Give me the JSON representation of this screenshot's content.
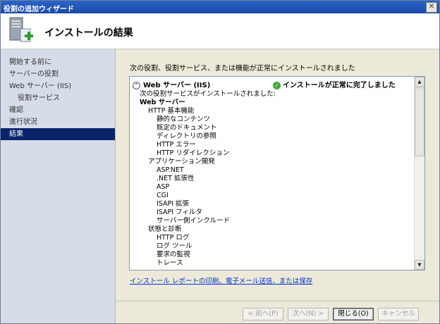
{
  "window": {
    "title": "役割の追加ウィザード",
    "close_glyph": "✕"
  },
  "header": {
    "title": "インストールの結果",
    "icon": "server-add-icon"
  },
  "nav": {
    "items": [
      {
        "label": "開始する前に",
        "active": false,
        "sub": false
      },
      {
        "label": "サーバーの役割",
        "active": false,
        "sub": false
      },
      {
        "label": "Web サーバー (IIS)",
        "active": false,
        "sub": false
      },
      {
        "label": "役割サービス",
        "active": false,
        "sub": true
      },
      {
        "label": "確認",
        "active": false,
        "sub": false
      },
      {
        "label": "進行状況",
        "active": false,
        "sub": false
      },
      {
        "label": "結果",
        "active": true,
        "sub": false
      }
    ]
  },
  "main": {
    "intro": "次の役割、役割サービス、または機能が正常にインストールされました",
    "listbox": {
      "chevron": "⌃",
      "role_name": "Web サーバー (IIS)",
      "status": "インストールが正常に完了しました",
      "status_glyph": "✓",
      "lines": [
        {
          "text": "次の役割サービスがインストールされました:",
          "indent": 0,
          "bold": false
        },
        {
          "text": "Web サーバー",
          "indent": 0,
          "bold": true
        },
        {
          "text": "HTTP 基本機能",
          "indent": 1,
          "bold": false
        },
        {
          "text": "静的なコンテンツ",
          "indent": 2,
          "bold": false
        },
        {
          "text": "既定のドキュメント",
          "indent": 2,
          "bold": false
        },
        {
          "text": "ディレクトリの参照",
          "indent": 2,
          "bold": false
        },
        {
          "text": "HTTP エラー",
          "indent": 2,
          "bold": false
        },
        {
          "text": "HTTP リダイレクション",
          "indent": 2,
          "bold": false
        },
        {
          "text": "アプリケーション開発",
          "indent": 1,
          "bold": false
        },
        {
          "text": "ASP.NET",
          "indent": 2,
          "bold": false
        },
        {
          "text": ".NET 拡張性",
          "indent": 2,
          "bold": false
        },
        {
          "text": "ASP",
          "indent": 2,
          "bold": false
        },
        {
          "text": "CGI",
          "indent": 2,
          "bold": false
        },
        {
          "text": "ISAPI 拡張",
          "indent": 2,
          "bold": false
        },
        {
          "text": "ISAPI フィルタ",
          "indent": 2,
          "bold": false
        },
        {
          "text": "サーバー側インクルード",
          "indent": 2,
          "bold": false
        },
        {
          "text": "状態と診断",
          "indent": 1,
          "bold": false
        },
        {
          "text": "HTTP ログ",
          "indent": 2,
          "bold": false
        },
        {
          "text": "ログ ツール",
          "indent": 2,
          "bold": false
        },
        {
          "text": "要求の監視",
          "indent": 2,
          "bold": false
        },
        {
          "text": "トレース",
          "indent": 2,
          "bold": false
        }
      ],
      "scroll_up": "▲",
      "scroll_down": "▼"
    },
    "report_link": "インストール レポートの印刷、電子メール送信、または保存"
  },
  "buttons": {
    "prev": "< 前へ(P)",
    "next": "次へ(N) >",
    "close": "閉じる(O)",
    "cancel": "キャンセル"
  }
}
